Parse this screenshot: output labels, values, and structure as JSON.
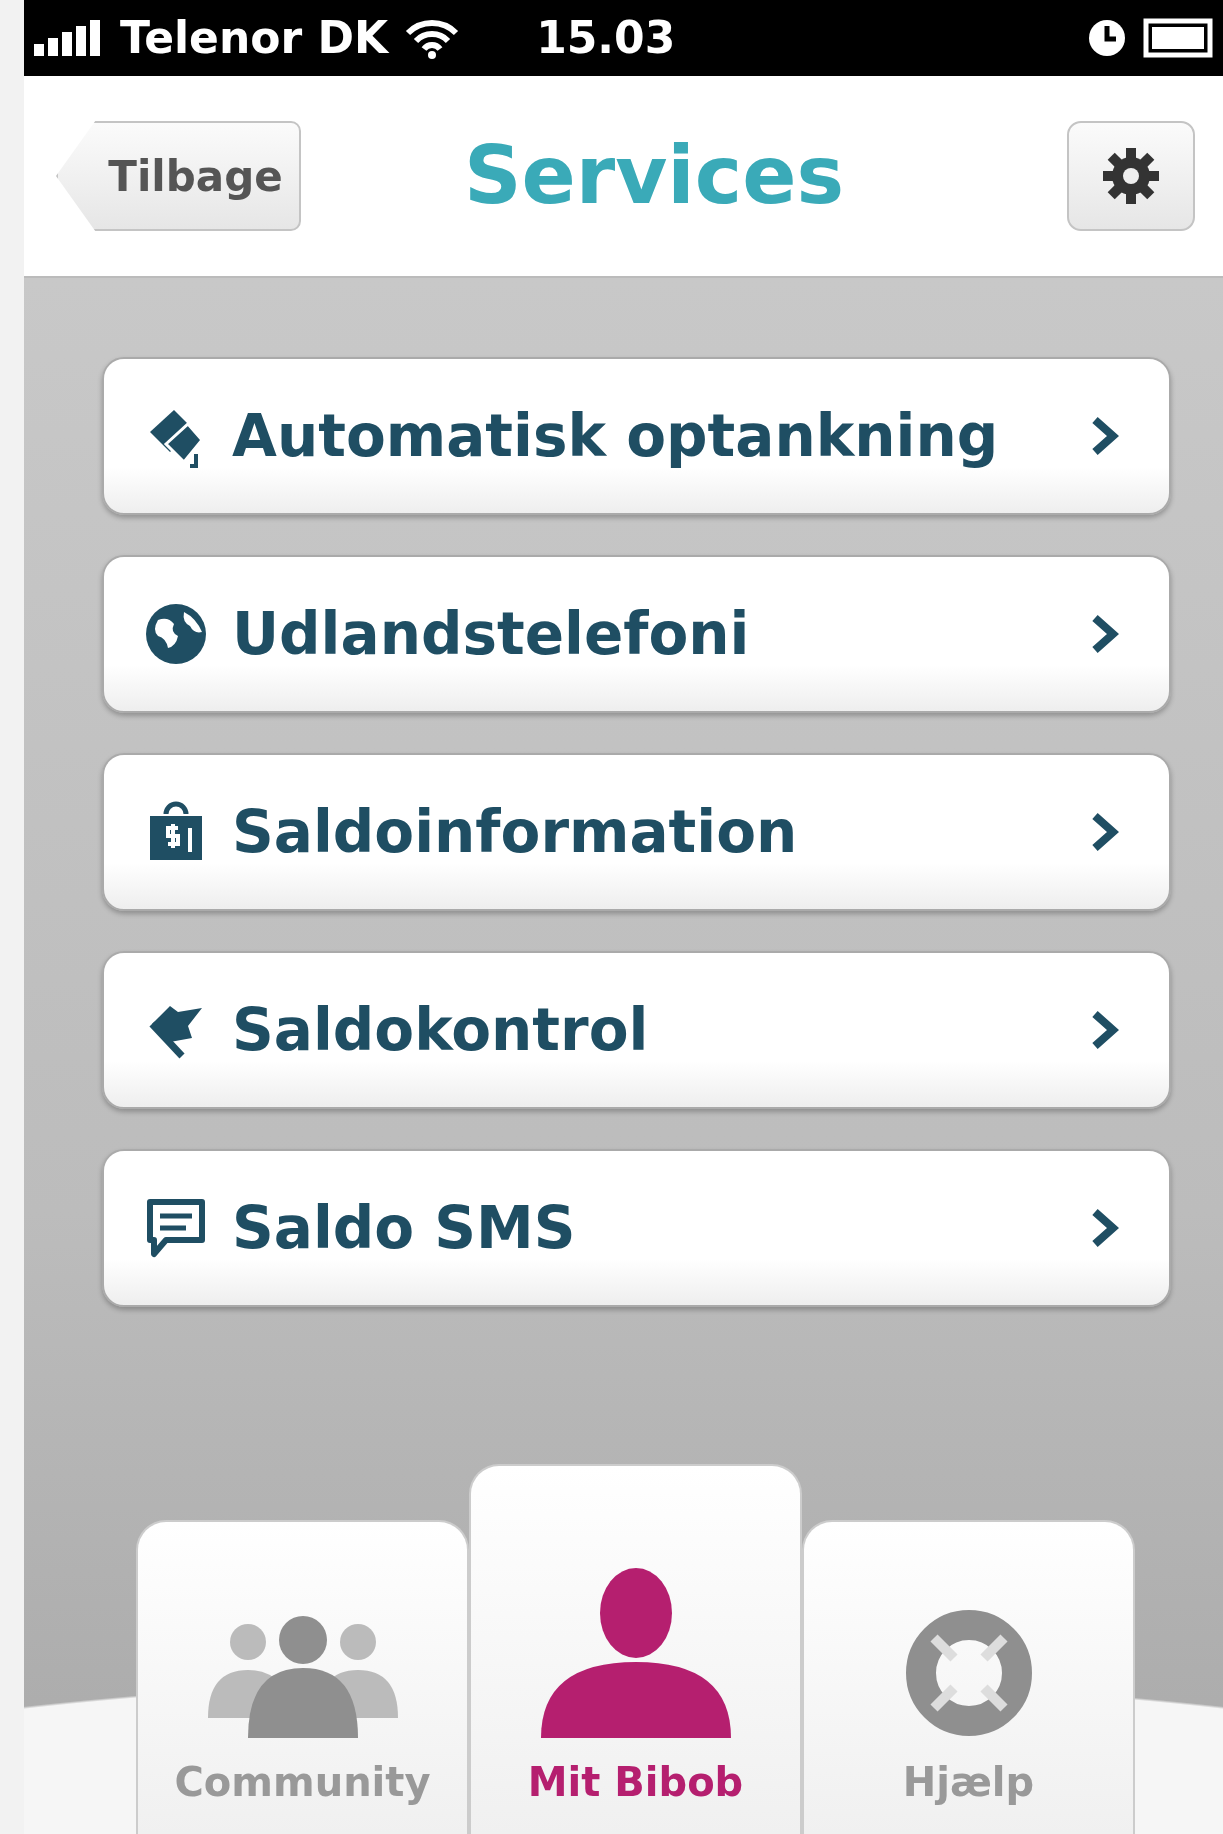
{
  "status_bar": {
    "carrier": "Telenor DK",
    "time": "15.03"
  },
  "header": {
    "back_button": "Tilbage",
    "title": "Services"
  },
  "menu_items": [
    {
      "label": "Automatisk optankning"
    },
    {
      "label": "Udlandstelefoni"
    },
    {
      "label": "Saldoinformation"
    },
    {
      "label": "Saldokontrol"
    },
    {
      "label": "Saldo SMS"
    }
  ],
  "tabs": [
    {
      "label": "Community",
      "selected": false
    },
    {
      "label": "Mit Bibob",
      "selected": true
    },
    {
      "label": "Hjælp",
      "selected": false
    }
  ]
}
